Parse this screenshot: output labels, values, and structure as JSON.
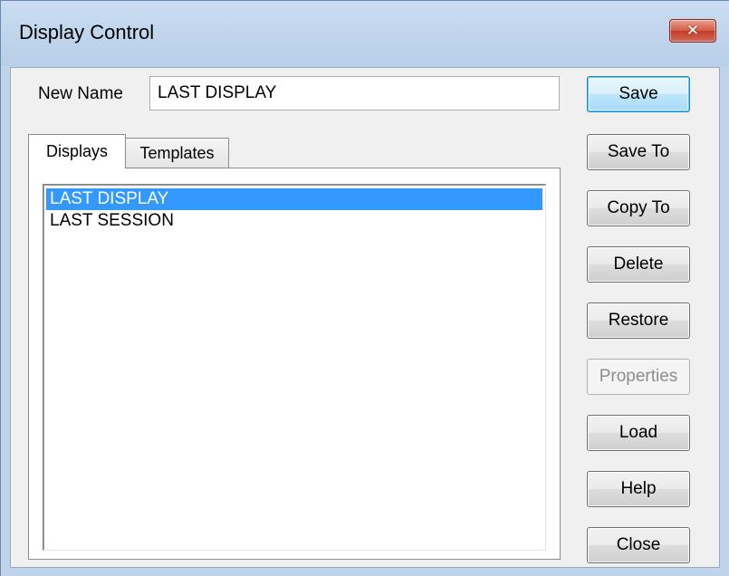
{
  "window": {
    "title": "Display Control",
    "close_glyph": "✕"
  },
  "form": {
    "new_name_label": "New Name",
    "new_name_value": "LAST DISPLAY"
  },
  "tabs": [
    {
      "label": "Displays",
      "active": true
    },
    {
      "label": "Templates",
      "active": false
    }
  ],
  "list": {
    "items": [
      {
        "label": "LAST DISPLAY",
        "selected": true
      },
      {
        "label": "LAST SESSION",
        "selected": false
      }
    ]
  },
  "buttons": {
    "save": "Save",
    "save_to": "Save To",
    "copy_to": "Copy To",
    "delete": "Delete",
    "restore": "Restore",
    "properties": "Properties",
    "load": "Load",
    "help": "Help",
    "close": "Close"
  },
  "colors": {
    "selection": "#3399ff",
    "close_button": "#c53b25",
    "title_bar": "#bfd3ea"
  }
}
